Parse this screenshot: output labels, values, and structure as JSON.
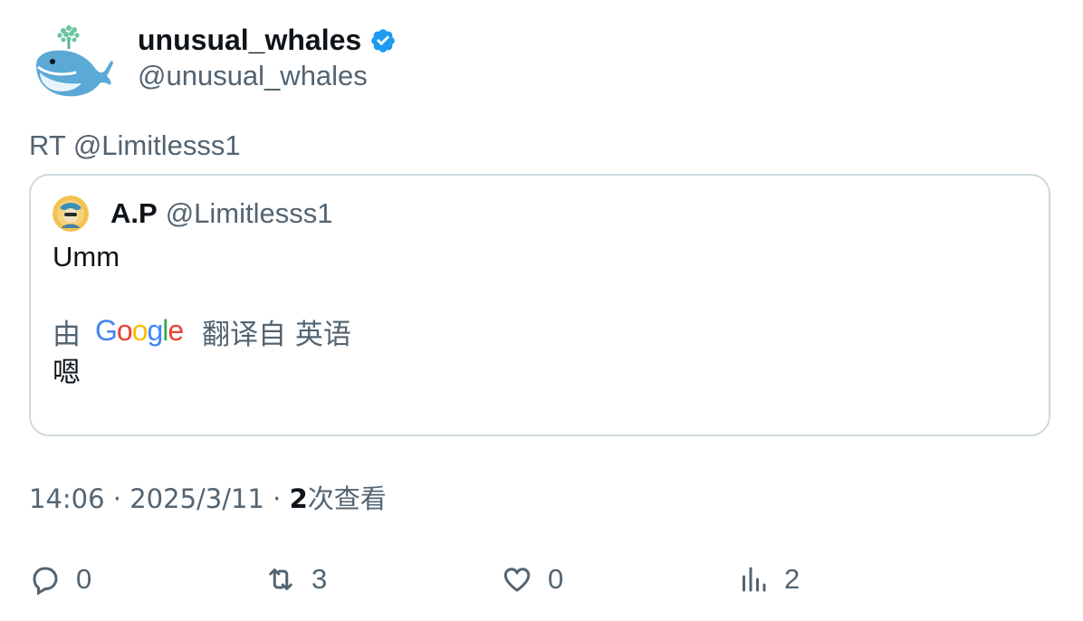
{
  "author": {
    "display_name": "unusual_whales",
    "handle": "@unusual_whales",
    "verified": true
  },
  "retweet_line": "RT @Limitlesss1",
  "quoted": {
    "display_name": "A.P",
    "handle": "@Limitlesss1",
    "text": "Umm",
    "translation": {
      "prefix": "由",
      "provider": "Google",
      "suffix": "翻译自 英语",
      "text": "嗯"
    }
  },
  "meta": {
    "time": "14:06",
    "separator": "·",
    "date": "2025/3/11",
    "views_count": "2",
    "views_label": "次查看"
  },
  "actions": {
    "replies": "0",
    "reposts": "3",
    "likes": "0",
    "views": "2"
  },
  "colors": {
    "text_primary": "#0f1419",
    "text_secondary": "#536471",
    "border": "#cfd9de",
    "verified_blue": "#1d9bf0"
  },
  "icons": [
    "whale-avatar-icon",
    "verified-badge-icon",
    "reply-icon",
    "repost-icon",
    "like-icon",
    "views-icon"
  ]
}
